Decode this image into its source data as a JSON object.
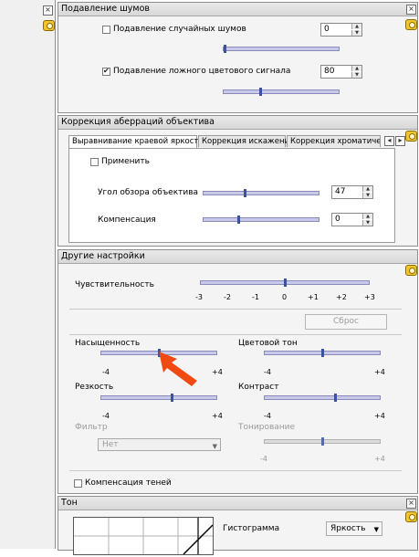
{
  "noise": {
    "title": "Подавление шумов",
    "random_noise": {
      "label": "Подавление случайных шумов",
      "checked": false,
      "value": "0",
      "level": 0.0
    },
    "false_color": {
      "label": "Подавление ложного цветового сигнала",
      "checked": true,
      "value": "80",
      "level": 0.32
    }
  },
  "aberration": {
    "title": "Коррекция аберраций объектива",
    "tabs": [
      "Выравнивание краевой яркости",
      "Коррекция искажений",
      "Коррекция хроматичес"
    ],
    "apply_label": "Применить",
    "lens_angle": {
      "label": "Угол обзора объектива",
      "value": "47",
      "level": 0.36
    },
    "compensation": {
      "label": "Компенсация",
      "value": "0",
      "level": 0.3
    }
  },
  "other": {
    "title": "Другие настройки",
    "sensitivity_label": "Чувствительность",
    "sensitivity_ticks": [
      "-3",
      "-2",
      "-1",
      "0",
      "+1",
      "+2",
      "+3"
    ],
    "sensitivity_level": 0.5,
    "reset_label": "Сброс",
    "saturation": {
      "label": "Насыщенность",
      "min": "-4",
      "max": "+4",
      "level": 0.5
    },
    "hue": {
      "label": "Цветовой тон",
      "min": "-4",
      "max": "+4",
      "level": 0.5
    },
    "sharpness": {
      "label": "Резкость",
      "min": "-4",
      "max": "+4",
      "level": 0.62
    },
    "contrast": {
      "label": "Контраст",
      "min": "-4",
      "max": "+4",
      "level": 0.62
    },
    "filter": {
      "label": "Фильтр",
      "value": "Нет"
    },
    "toning": {
      "label": "Тонирование",
      "min": "-4",
      "max": "+4",
      "level": 0.5
    },
    "shadow_comp_label": "Компенсация теней"
  },
  "tone": {
    "title": "Тон",
    "histogram_label": "Гистограмма",
    "channel": "Яркость"
  },
  "colors": {
    "accent_arrow": "#f04a12",
    "track": "#c8c8ea",
    "thumb": "#3b52a0"
  }
}
